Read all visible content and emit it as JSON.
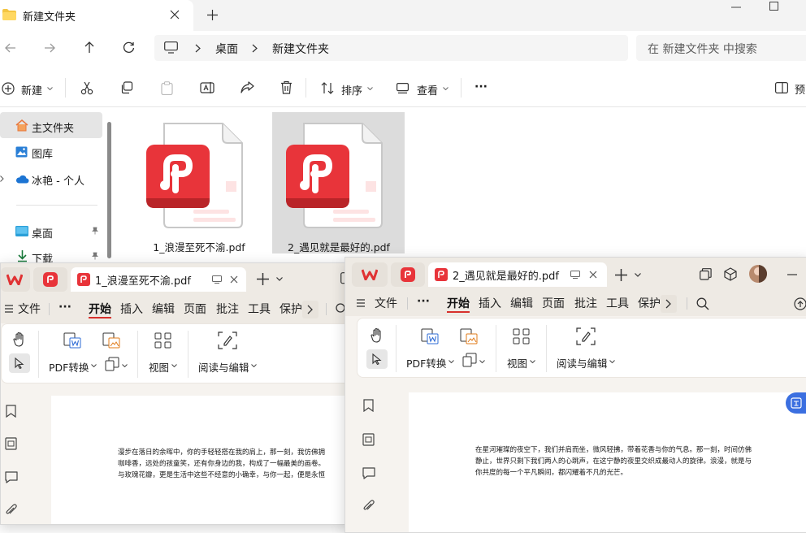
{
  "explorer": {
    "tab_title": "新建文件夹",
    "breadcrumb": [
      "桌面",
      "新建文件夹"
    ],
    "search_placeholder": "在 新建文件夹 中搜索",
    "toolbar": {
      "new": "新建",
      "sort": "排序",
      "view": "查看",
      "more": "···",
      "preview": "预"
    },
    "sidebar": [
      {
        "label": "主文件夹",
        "icon": "home-icon"
      },
      {
        "label": "图库",
        "icon": "gallery-icon"
      },
      {
        "label": "冰艳 - 个人",
        "icon": "cloud-icon"
      },
      {
        "label": "桌面",
        "icon": "desktop-icon"
      },
      {
        "label": "下载",
        "icon": "download-icon"
      }
    ],
    "files": [
      {
        "name": "1_浪漫至死不渝.pdf",
        "icon": "pdf-file-icon"
      },
      {
        "name": "2_遇见就是最好的.pdf",
        "icon": "pdf-file-icon"
      }
    ]
  },
  "wps1": {
    "tab_title": "1_浪漫至死不渝.pdf",
    "menu": [
      "文件",
      "···",
      "开始",
      "插入",
      "编辑",
      "页面",
      "批注",
      "工具",
      "保护"
    ],
    "active_menu": "开始",
    "ribbon": {
      "pdf_convert": "PDF转换",
      "view": "视图",
      "read_edit": "阅读与编辑"
    },
    "doc_lines": [
      "漫步在落日的余晖中，你的手轻轻搭在我的肩上，那一刻，我仿佛拥",
      "咖啡香，远处的孩童笑，还有你身边的我，构成了一幅最美的画卷。",
      "与玫瑰花瓣，更是生活中这些不经意的小确幸，与你一起，便是永恒"
    ]
  },
  "wps2": {
    "tab_title": "2_遇见就是最好的.pdf",
    "menu": [
      "文件",
      "···",
      "开始",
      "插入",
      "编辑",
      "页面",
      "批注",
      "工具",
      "保护"
    ],
    "active_menu": "开始",
    "ribbon": {
      "pdf_convert": "PDF转换",
      "view": "视图",
      "read_edit": "阅读与编辑"
    },
    "doc_lines": [
      "在星河璀璨的夜空下，我们并肩而坐，微风轻拂，带着花香与你的气息。那一刻，时间仿佛",
      "静止，世界只剩下我们两人的心跳声，在这宁静的夜里交织成最动人的旋律。浪漫，就是与",
      "你共度的每一个平凡瞬间，都闪耀着不凡的光芒。"
    ]
  },
  "colors": {
    "wps_red": "#e03233",
    "accent_underline": "#d7302c",
    "pdf_red": "#e8343a"
  }
}
